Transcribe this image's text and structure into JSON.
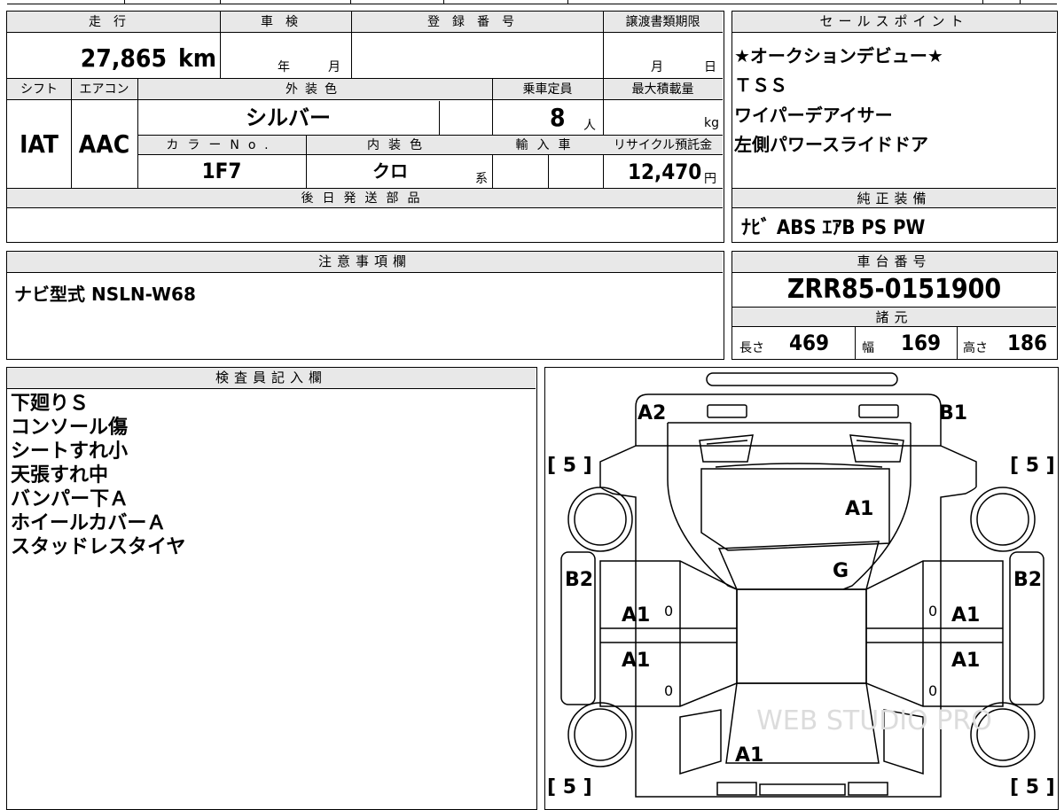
{
  "main_table": {
    "mileage_label": "走行",
    "mileage_value": "27,865",
    "mileage_unit": "km",
    "inspection_label": "車検",
    "inspection_year_label": "年",
    "inspection_month_label": "月",
    "registration_label": "登録番号",
    "transfer_deadline_label": "譲渡書類期限",
    "transfer_month_label": "月",
    "transfer_day_label": "日",
    "shift_label": "シフト",
    "shift_value": "IAT",
    "aircon_label": "エアコン",
    "aircon_value": "AAC",
    "exterior_color_label": "外装色",
    "exterior_color_value": "シルバー",
    "capacity_label": "乗車定員",
    "capacity_value": "8",
    "capacity_unit": "人",
    "max_load_label": "最大積載量",
    "max_load_unit": "kg",
    "color_no_label": "カラーNo.",
    "color_no_value": "1F7",
    "interior_color_label": "内装色",
    "interior_color_value": "クロ",
    "interior_color_suffix": "系",
    "import_label": "輸入車",
    "recycle_label": "リサイクル預託金",
    "recycle_value": "12,470",
    "recycle_unit": "円",
    "later_parts_label": "後日発送部品"
  },
  "sales_points": {
    "label": "セールスポイント",
    "items": [
      "★オークションデビュー★",
      "ＴＳＳ",
      "ワイパーデアイサー",
      "左側パワースライドドア"
    ]
  },
  "genuine_equipment": {
    "label": "純正装備",
    "value": "ﾅﾋﾞ ABS ｴｱB PS PW"
  },
  "notes": {
    "label": "注意事項欄",
    "value": "ナビ型式 NSLN-W68"
  },
  "chassis": {
    "label": "車台番号",
    "value": "ZRR85-0151900",
    "specs_label": "諸元",
    "length_label": "長さ",
    "length_value": "469",
    "width_label": "幅",
    "width_value": "169",
    "height_label": "高さ",
    "height_value": "186"
  },
  "inspector": {
    "label": "検査員記入欄",
    "lines": [
      "下廻りＳ",
      "コンソール傷",
      "シートすれ小",
      "天張すれ中",
      "バンパー下Ａ",
      "ホイールカバーＡ",
      "スタッドレスタイヤ"
    ]
  },
  "diagram": {
    "marks": [
      "A2",
      "B1",
      "A1",
      "G",
      "B2",
      "B2",
      "A1",
      "A1",
      "A1",
      "A1",
      "A1"
    ],
    "tire_tl": "[ 5 ]",
    "tire_tr": "[ 5 ]",
    "tire_bl": "[ 5 ]",
    "tire_br": "[ 5 ]",
    "zero_marks": [
      "0",
      "0",
      "0",
      "0"
    ],
    "watermark": "WEB STUDIO PRO"
  }
}
